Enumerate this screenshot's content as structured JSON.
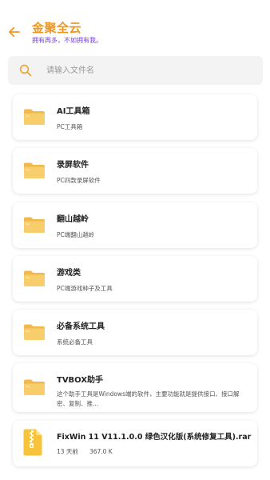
{
  "header": {
    "title": "金聚全云",
    "subtitle": "拥有再多，不如拥有我。"
  },
  "search": {
    "placeholder": "请输入文件名"
  },
  "folders": [
    {
      "name": "AI工具箱",
      "desc": "PC工具箱"
    },
    {
      "name": "录屏软件",
      "desc": "PC四款录屏软件"
    },
    {
      "name": "翻山越岭",
      "desc": "PC端翻山越岭"
    },
    {
      "name": "游戏类",
      "desc": "PC端游戏种子及工具"
    },
    {
      "name": "必备系统工具",
      "desc": "系统必备工具"
    },
    {
      "name": "TVBOX助手",
      "desc": "这个助手工具是Windows端的软件，主要功能就是提供接口、接口解密、复制、推..."
    }
  ],
  "files": [
    {
      "name": "FixWin 11 V11.1.0.0 绿色汉化版(系统修复工具).rar",
      "time": "13 天前",
      "size": "367.0 K"
    }
  ],
  "colors": {
    "accent": "#f0961e",
    "subtitle": "#7b3fe4",
    "folder": "#f7c55a",
    "search_bg": "#f3f3f3"
  },
  "icons": {
    "back": "arrow-left-icon",
    "search": "search-icon",
    "folder": "folder-icon",
    "archive": "zip-file-icon"
  }
}
